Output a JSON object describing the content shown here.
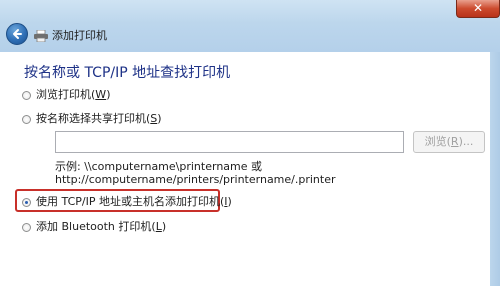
{
  "window": {
    "close_glyph": "✕",
    "title": "添加打印机"
  },
  "content": {
    "heading": "按名称或 TCP/IP 地址查找打印机",
    "options": [
      {
        "label": "浏览打印机(",
        "key": "W",
        "suffix": ")",
        "selected": false
      },
      {
        "label": "按名称选择共享打印机(",
        "key": "S",
        "suffix": ")",
        "selected": false
      },
      {
        "label": "使用 TCP/IP 地址或主机名添加打印机(",
        "key": "I",
        "suffix": ")",
        "selected": true
      },
      {
        "label": "添加 Bluetooth 打印机(",
        "key": "L",
        "suffix": ")",
        "selected": false
      }
    ],
    "shared_printer_input": {
      "value": "",
      "placeholder": ""
    },
    "browse_button": {
      "label": "浏览(",
      "key": "R",
      "suffix": ")..."
    },
    "example_line1": "示例: \\\\computername\\printername 或",
    "example_line2": "http://computername/printers/printername/.printer"
  },
  "colors": {
    "heading": "#1e3287",
    "highlight_border": "#c8302a",
    "frame": "#bcd6ec"
  },
  "icons": [
    "back-arrow-icon",
    "printer-icon",
    "close-icon"
  ]
}
